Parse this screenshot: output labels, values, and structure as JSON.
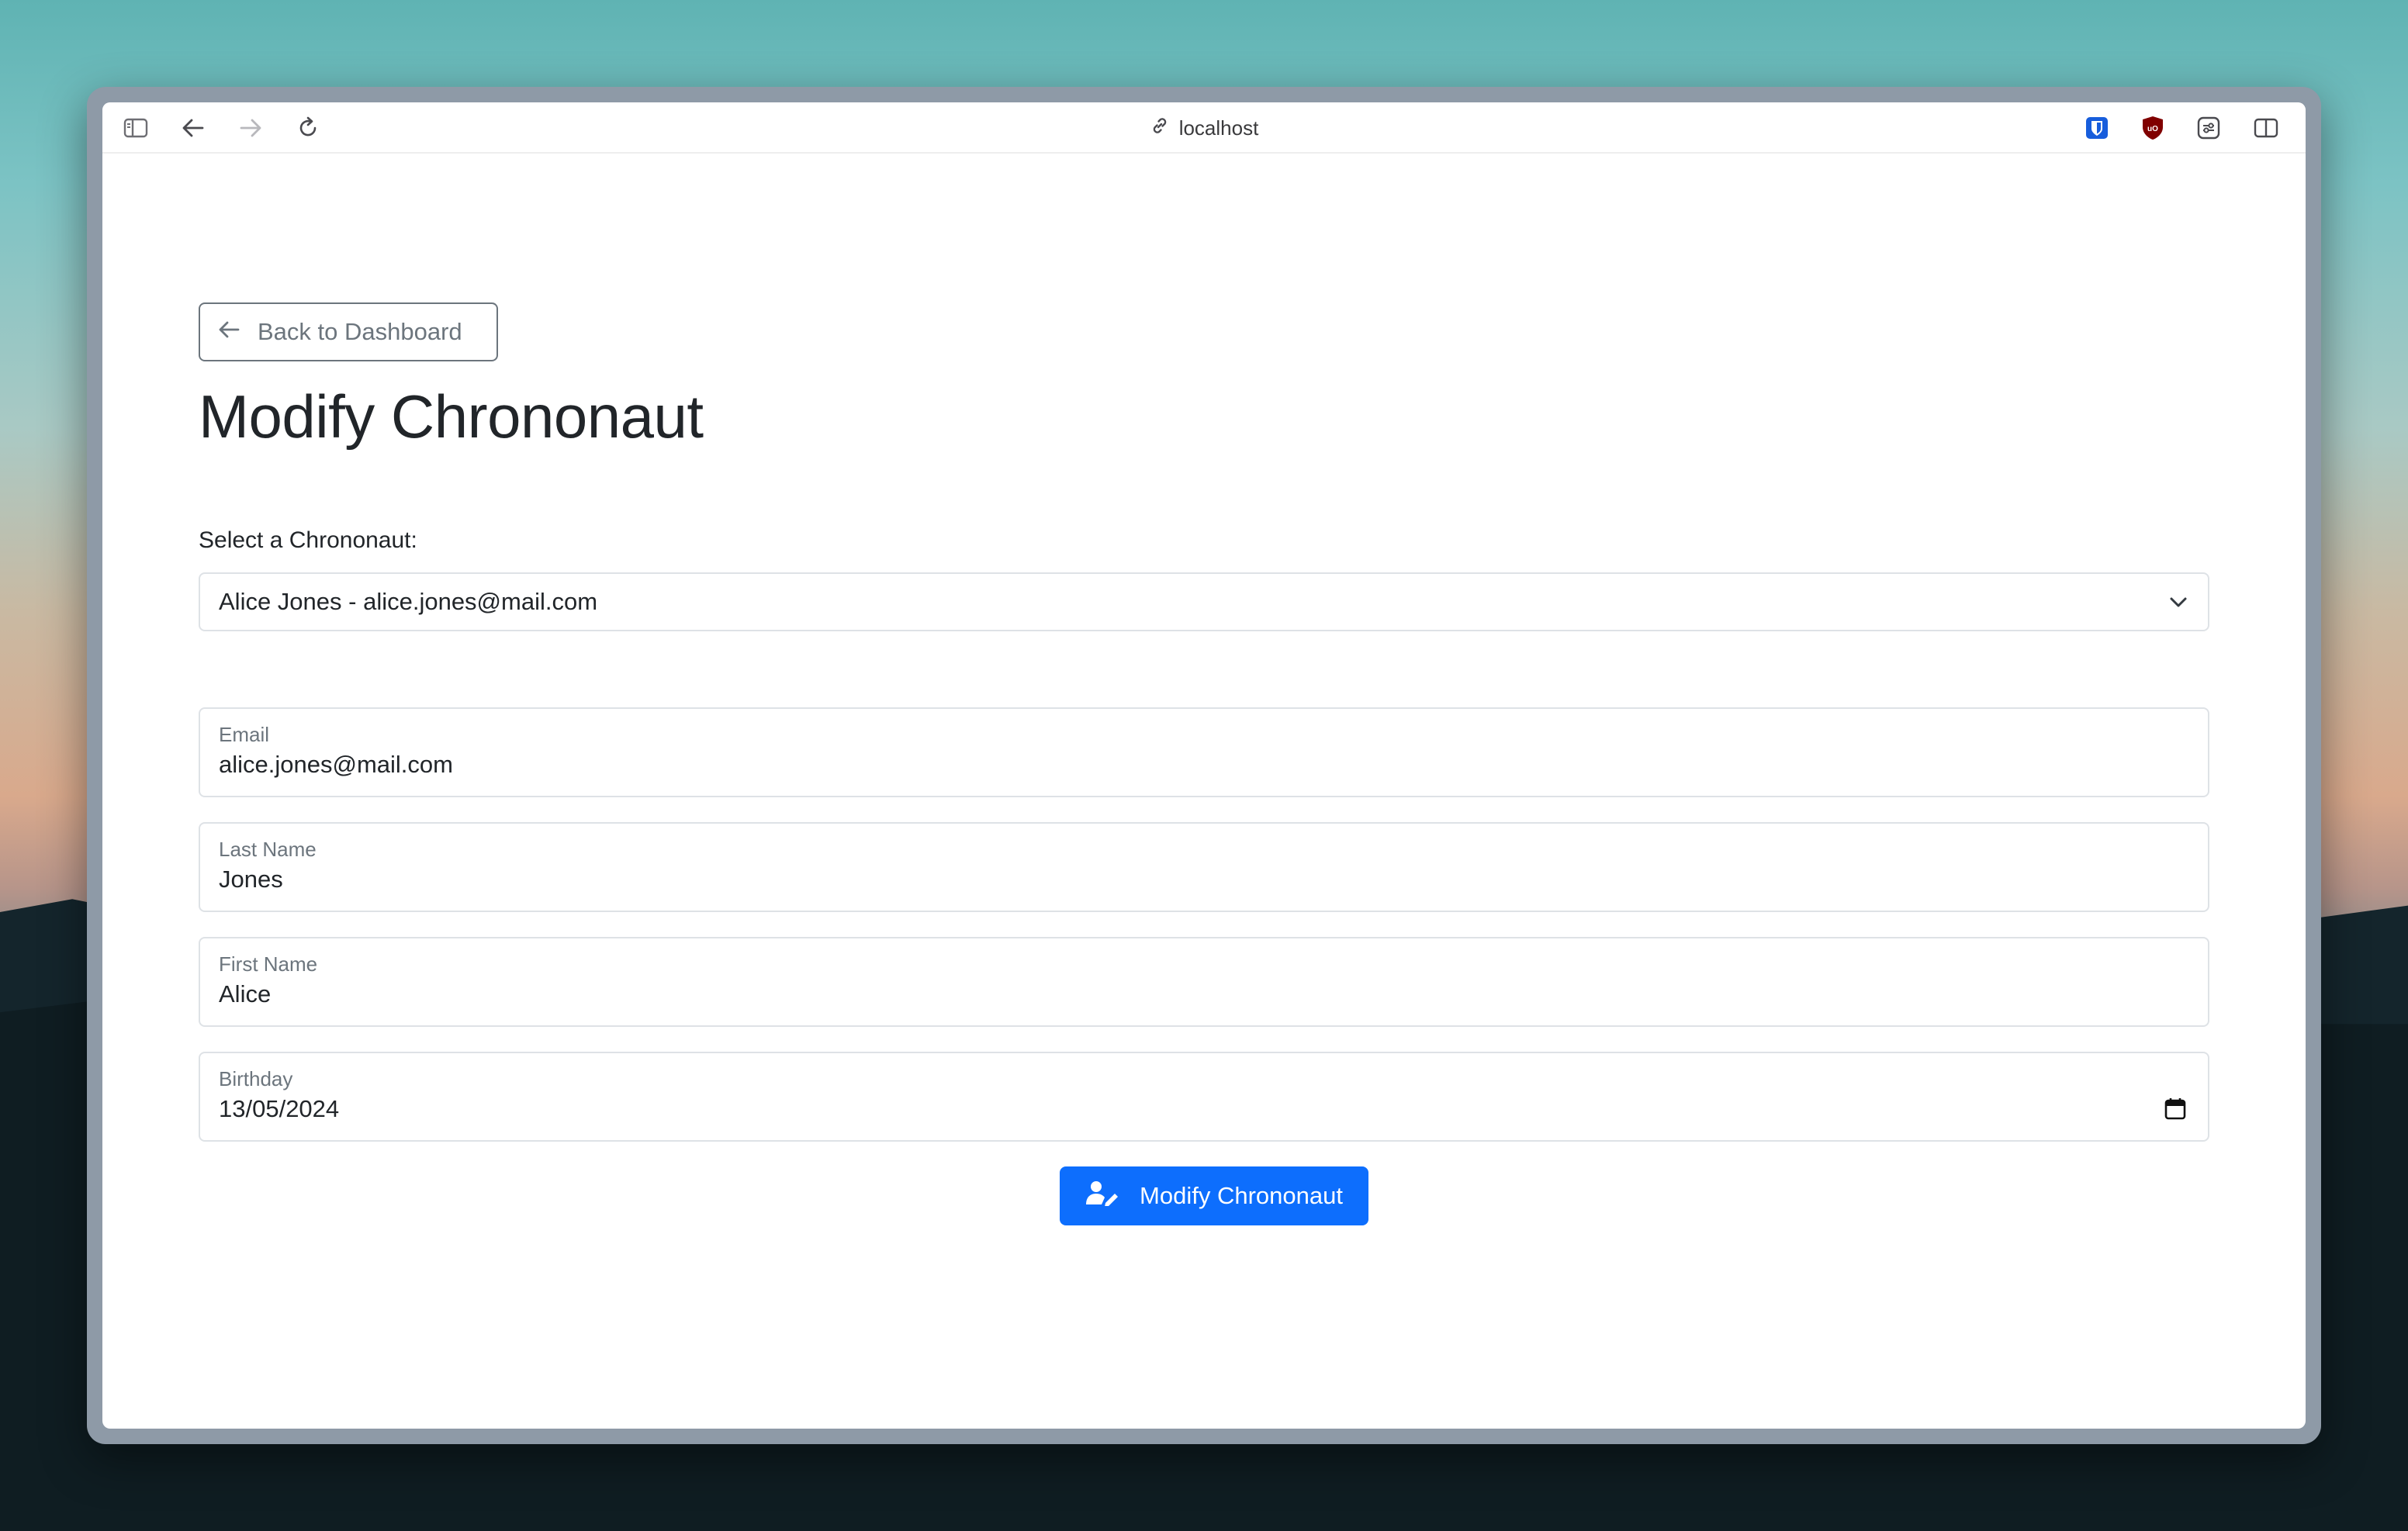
{
  "browser": {
    "url": "localhost",
    "icons": [
      "sidebar-icon",
      "back-arrow-icon",
      "forward-arrow-icon",
      "reload-icon",
      "link-icon",
      "bitwarden-icon",
      "ublock-icon",
      "extension-icon",
      "split-view-icon"
    ]
  },
  "page": {
    "back_button": "Back to Dashboard",
    "title": "Modify Chrononaut",
    "select_label": "Select a Chrononaut:",
    "selected_chrononaut": "Alice Jones - alice.jones@mail.com",
    "fields": {
      "email": {
        "label": "Email",
        "value": "alice.jones@mail.com"
      },
      "last_name": {
        "label": "Last Name",
        "value": "Jones"
      },
      "first_name": {
        "label": "First Name",
        "value": "Alice"
      },
      "birthday": {
        "label": "Birthday",
        "value": "13/05/2024"
      }
    },
    "submit_button": "Modify Chrononaut"
  },
  "colors": {
    "primary": "#0d6efd",
    "secondary": "#6c757d",
    "border": "#dee2e6",
    "text": "#212529"
  }
}
